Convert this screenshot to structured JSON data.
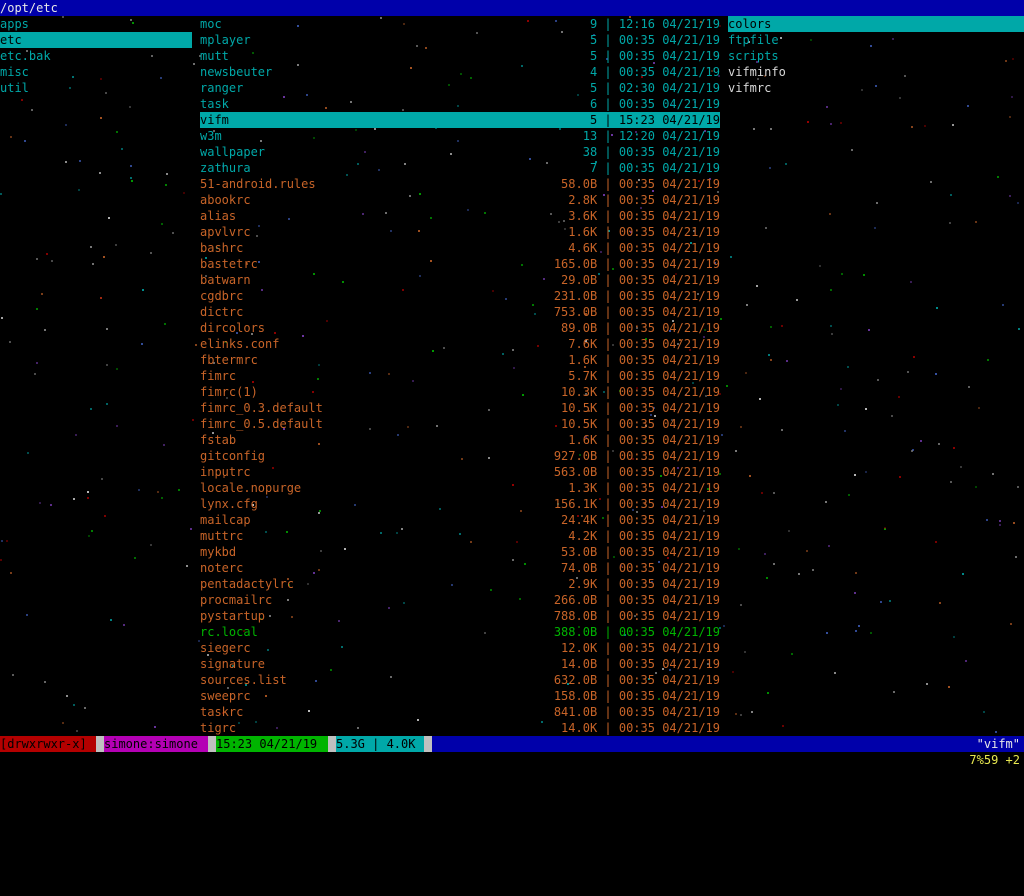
{
  "title_path": "/opt/etc",
  "left_panel": [
    {
      "label": "apps",
      "selected": false
    },
    {
      "label": "etc",
      "selected": true
    },
    {
      "label": "etc.bak",
      "selected": false
    },
    {
      "label": "misc",
      "selected": false
    },
    {
      "label": "util",
      "selected": false
    }
  ],
  "middle_panel": [
    {
      "name": "moc",
      "info": "9 | 12:16 04/21/19",
      "kind": "dir"
    },
    {
      "name": "mplayer",
      "info": "5 | 00:35 04/21/19",
      "kind": "dir"
    },
    {
      "name": "mutt",
      "info": "5 | 00:35 04/21/19",
      "kind": "dir"
    },
    {
      "name": "newsbeuter",
      "info": "4 | 00:35 04/21/19",
      "kind": "dir"
    },
    {
      "name": "ranger",
      "info": "5 | 02:30 04/21/19",
      "kind": "dir"
    },
    {
      "name": "task",
      "info": "6 | 00:35 04/21/19",
      "kind": "dir"
    },
    {
      "name": "vifm",
      "info": "5 | 15:23 04/21/19",
      "kind": "dir",
      "selected": true
    },
    {
      "name": "w3m",
      "info": "13 | 12:20 04/21/19",
      "kind": "dir"
    },
    {
      "name": "wallpaper",
      "info": "38 | 00:35 04/21/19",
      "kind": "dir"
    },
    {
      "name": "zathura",
      "info": "7 | 00:35 04/21/19",
      "kind": "dir"
    },
    {
      "name": "51-android.rules",
      "info": "58.0B | 00:35 04/21/19",
      "kind": "file"
    },
    {
      "name": "abookrc",
      "info": "2.8K | 00:35 04/21/19",
      "kind": "file"
    },
    {
      "name": "alias",
      "info": "3.6K | 00:35 04/21/19",
      "kind": "file"
    },
    {
      "name": "apvlvrc",
      "info": "1.6K | 00:35 04/21/19",
      "kind": "file"
    },
    {
      "name": "bashrc",
      "info": "4.6K | 00:35 04/21/19",
      "kind": "file"
    },
    {
      "name": "bastetrc",
      "info": "165.0B | 00:35 04/21/19",
      "kind": "file"
    },
    {
      "name": "batwarn",
      "info": "29.0B | 00:35 04/21/19",
      "kind": "file"
    },
    {
      "name": "cgdbrc",
      "info": "231.0B | 00:35 04/21/19",
      "kind": "file"
    },
    {
      "name": "dictrc",
      "info": "753.0B | 00:35 04/21/19",
      "kind": "file"
    },
    {
      "name": "dircolors",
      "info": "89.0B | 00:35 04/21/19",
      "kind": "file"
    },
    {
      "name": "elinks.conf",
      "info": "7.6K | 00:35 04/21/19",
      "kind": "file"
    },
    {
      "name": "fbtermrc",
      "info": "1.6K | 00:35 04/21/19",
      "kind": "file"
    },
    {
      "name": "fimrc",
      "info": "5.7K | 00:35 04/21/19",
      "kind": "file"
    },
    {
      "name": "fimrc(1)",
      "info": "10.3K | 00:35 04/21/19",
      "kind": "file"
    },
    {
      "name": "fimrc_0.3.default",
      "info": "10.5K | 00:35 04/21/19",
      "kind": "file"
    },
    {
      "name": "fimrc_0.5.default",
      "info": "10.5K | 00:35 04/21/19",
      "kind": "file"
    },
    {
      "name": "fstab",
      "info": "1.6K | 00:35 04/21/19",
      "kind": "file"
    },
    {
      "name": "gitconfig",
      "info": "927.0B | 00:35 04/21/19",
      "kind": "file"
    },
    {
      "name": "inputrc",
      "info": "563.0B | 00:35 04/21/19",
      "kind": "file"
    },
    {
      "name": "locale.nopurge",
      "info": "1.3K | 00:35 04/21/19",
      "kind": "file"
    },
    {
      "name": "lynx.cfg",
      "info": "156.1K | 00:35 04/21/19",
      "kind": "file"
    },
    {
      "name": "mailcap",
      "info": "24.4K | 00:35 04/21/19",
      "kind": "file"
    },
    {
      "name": "muttrc",
      "info": "4.2K | 00:35 04/21/19",
      "kind": "file"
    },
    {
      "name": "mykbd",
      "info": "53.0B | 00:35 04/21/19",
      "kind": "file"
    },
    {
      "name": "noterc",
      "info": "74.0B | 00:35 04/21/19",
      "kind": "file"
    },
    {
      "name": "pentadactylrc",
      "info": "2.9K | 00:35 04/21/19",
      "kind": "file"
    },
    {
      "name": "procmailrc",
      "info": "266.0B | 00:35 04/21/19",
      "kind": "file"
    },
    {
      "name": "pystartup",
      "info": "788.0B | 00:35 04/21/19",
      "kind": "file"
    },
    {
      "name": "rc.local",
      "info": "388.0B | 00:35 04/21/19",
      "kind": "exec"
    },
    {
      "name": "siegerc",
      "info": "12.0K | 00:35 04/21/19",
      "kind": "file"
    },
    {
      "name": "signature",
      "info": "14.0B | 00:35 04/21/19",
      "kind": "file"
    },
    {
      "name": "sources.list",
      "info": "632.0B | 00:35 04/21/19",
      "kind": "file"
    },
    {
      "name": "sweeprc",
      "info": "158.0B | 00:35 04/21/19",
      "kind": "file"
    },
    {
      "name": "taskrc",
      "info": "841.0B | 00:35 04/21/19",
      "kind": "file"
    },
    {
      "name": "tigrc",
      "info": "14.0K | 00:35 04/21/19",
      "kind": "file"
    }
  ],
  "right_panel": [
    {
      "label": "colors",
      "kind": "dir",
      "selected": true
    },
    {
      "label": "ftpfile",
      "kind": "dir"
    },
    {
      "label": "scripts",
      "kind": "dir"
    },
    {
      "label": "vifminfo",
      "kind": "file"
    },
    {
      "label": "vifmrc",
      "kind": "file"
    }
  ],
  "status": {
    "permissions": "[drwxrwxr-x]",
    "owner": "simone:simone",
    "datetime": "15:23 04/21/19",
    "size": "5.3G | 4.0K",
    "app_name": "\"vifm\""
  },
  "cmdline": {
    "position": "7%59 +2"
  },
  "colors": {
    "titlebar": "#0000aa",
    "selection": "#00a8a8",
    "dir": "#00a8a8",
    "file": "#c86428",
    "exec": "#00b400",
    "perm_bg": "#b40000",
    "owner_bg": "#b400b4",
    "date_bg": "#00b400",
    "size_bg": "#00a8a8",
    "cmd_text": "#e8e850"
  }
}
